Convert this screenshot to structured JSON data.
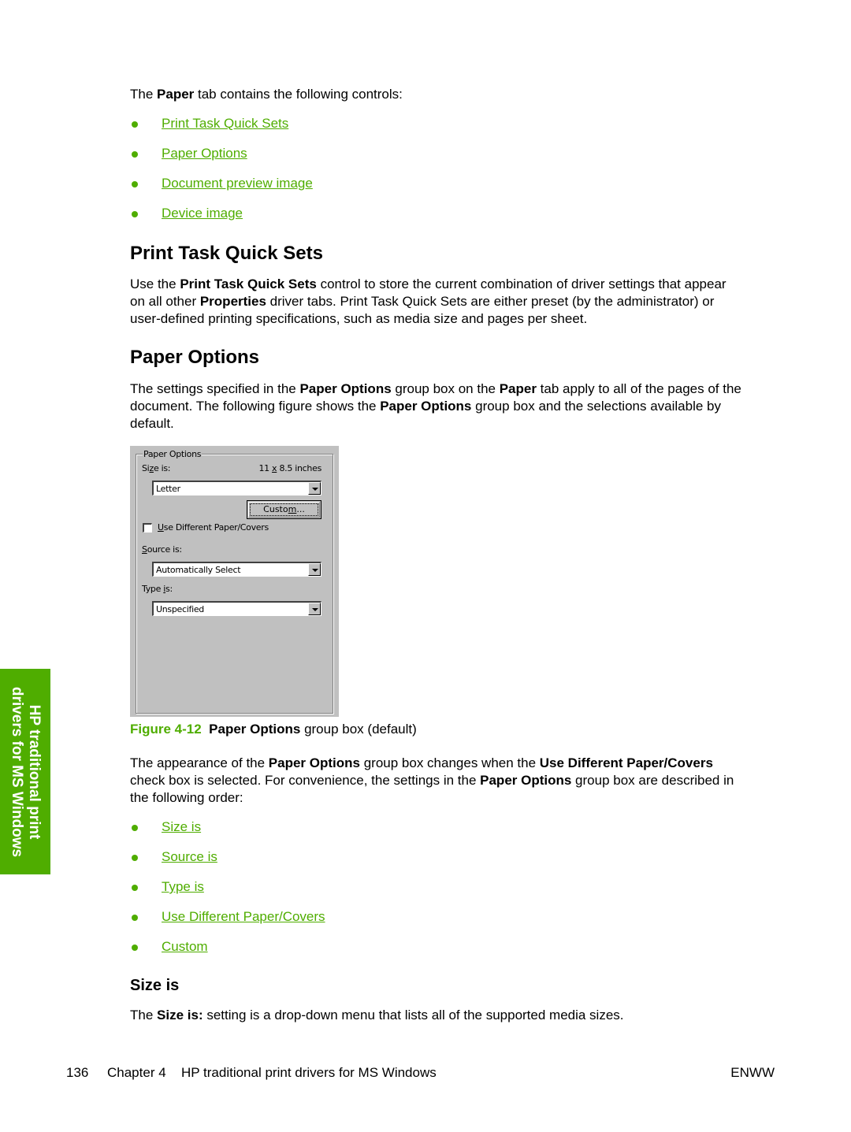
{
  "intro": {
    "prefix": "The ",
    "bold": "Paper",
    "suffix": " tab contains the following controls:"
  },
  "controls_list": [
    {
      "label": "Print Task Quick Sets"
    },
    {
      "label": "Paper Options"
    },
    {
      "label": "Document preview image"
    },
    {
      "label": "Device image"
    }
  ],
  "section_quick_sets": {
    "heading": "Print Task Quick Sets",
    "p1_a": "Use the ",
    "p1_b": "Print Task Quick Sets",
    "p1_c": " control to store the current combination of driver settings that appear",
    "p2_a": "on all other ",
    "p2_b": "Properties",
    "p2_c": " driver tabs. Print Task Quick Sets are either preset (by the administrator) or",
    "p3": "user-defined printing specifications, such as media size and pages per sheet."
  },
  "section_paper_options": {
    "heading": "Paper Options",
    "l1_a": "The settings specified in the ",
    "l1_b": "Paper Options",
    "l1_c": " group box on the ",
    "l1_d": "Paper",
    "l1_e": " tab apply to all of the pages of the",
    "l2_a": "document. The following figure shows the ",
    "l2_b": "Paper Options",
    "l2_c": " group box and the selections available by",
    "l3": "default."
  },
  "dialog": {
    "group_title": "Paper Options",
    "size_label_pre": "Si",
    "size_label_acc": "z",
    "size_label_post": "e is:",
    "size_dims_pre": "11 ",
    "size_dims_acc": "x",
    "size_dims_post": " 8.5 inches",
    "size_value": "Letter",
    "custom_button_pre": "Custo",
    "custom_button_acc": "m",
    "custom_button_post": "...",
    "checkbox_acc": "U",
    "checkbox_label": "se Different Paper/Covers",
    "checkbox_checked": false,
    "source_label_acc": "S",
    "source_label_post": "ource is:",
    "source_value": "Automatically Select",
    "type_label_pre": "Type ",
    "type_label_acc": "i",
    "type_label_post": "s:",
    "type_value": "Unspecified"
  },
  "figure_caption": {
    "number": "Figure 4-12",
    "bold": "Paper Options",
    "rest": " group box (default)"
  },
  "appearance_paragraph": {
    "l1_a": "The appearance of the ",
    "l1_b": "Paper Options",
    "l1_c": " group box changes when the ",
    "l1_d": "Use Different Paper/Covers",
    "l2_a": "check box is selected. For convenience, the settings in the ",
    "l2_b": "Paper Options",
    "l2_c": " group box are described in",
    "l3": "the following order:"
  },
  "settings_list": [
    {
      "label": "Size is"
    },
    {
      "label": "Source is"
    },
    {
      "label": "Type is"
    },
    {
      "label": "Use Different Paper/Covers"
    },
    {
      "label": "Custom"
    }
  ],
  "section_size_is": {
    "heading": "Size is",
    "p_a": "The ",
    "p_b": "Size is:",
    "p_c": " setting is a drop-down menu that lists all of the supported media sizes."
  },
  "side_tab": {
    "line1": "HP traditional print",
    "line2": "drivers for MS Windows"
  },
  "footer": {
    "page_number": "136",
    "chapter": "Chapter 4",
    "chapter_title": "HP traditional print drivers for MS Windows",
    "locale": "ENWW"
  },
  "colors": {
    "accent_green": "#4fad00",
    "dialog_gray": "#c0c0c0"
  }
}
